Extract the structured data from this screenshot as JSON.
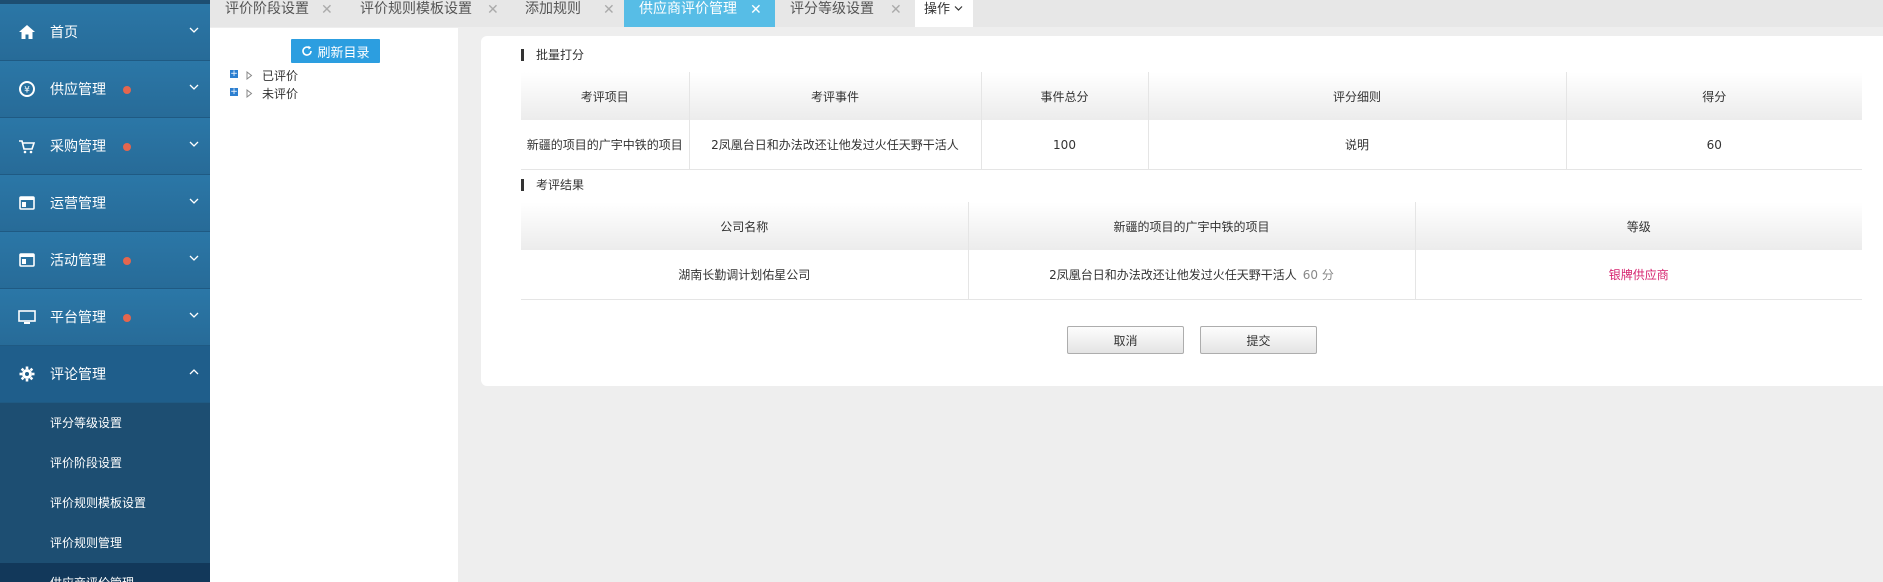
{
  "sidebar": {
    "items": [
      {
        "label": "首页",
        "icon": "home-icon",
        "dot": false
      },
      {
        "label": "供应管理",
        "icon": "supply-icon",
        "dot": true
      },
      {
        "label": "采购管理",
        "icon": "cart-icon",
        "dot": true
      },
      {
        "label": "运营管理",
        "icon": "window-icon",
        "dot": false
      },
      {
        "label": "活动管理",
        "icon": "window-icon",
        "dot": true
      },
      {
        "label": "平台管理",
        "icon": "monitor-icon",
        "dot": true
      },
      {
        "label": "评论管理",
        "icon": "gear-icon",
        "dot": false,
        "open": true
      }
    ],
    "subitems": [
      {
        "label": "评分等级设置"
      },
      {
        "label": "评价阶段设置"
      },
      {
        "label": "评价规则模板设置"
      },
      {
        "label": "评价规则管理"
      },
      {
        "label": "供应商评价管理",
        "active": true
      }
    ],
    "dot_color": "#e4664e"
  },
  "tabs": [
    {
      "label": "评价阶段设置"
    },
    {
      "label": "评价规则模板设置"
    },
    {
      "label": "添加规则"
    },
    {
      "label": "供应商评价管理",
      "active": true
    },
    {
      "label": "评分等级设置"
    }
  ],
  "tab_op": {
    "label": "操作"
  },
  "tree": {
    "refresh_label": "刷新目录",
    "nodes": [
      {
        "label": "已评价"
      },
      {
        "label": "未评价"
      }
    ]
  },
  "batch": {
    "title": "批量打分",
    "headers": [
      "考评项目",
      "考评事件",
      "事件总分",
      "评分细则",
      "得分"
    ],
    "row": [
      "新疆的项目的广宇中铁的项目",
      "2凤凰台日和办法改还让他发过火任天野干活人",
      "100",
      "说明",
      "60"
    ]
  },
  "result": {
    "title": "考评结果",
    "headers": [
      "公司名称",
      "新疆的项目的广宇中铁的项目",
      "等级"
    ],
    "company": "湖南长勤调计划佑星公司",
    "event": "2凤凰台日和办法改还让他发过火任天野干活人",
    "score": "60 分",
    "grade": "银牌供应商",
    "grade_color": "#d6246f"
  },
  "buttons": {
    "cancel": "取消",
    "submit": "提交"
  },
  "colors": {
    "sidebar": "#276b98",
    "active_tab": "#57bde6",
    "refresh_button": "#2c9ee0"
  }
}
